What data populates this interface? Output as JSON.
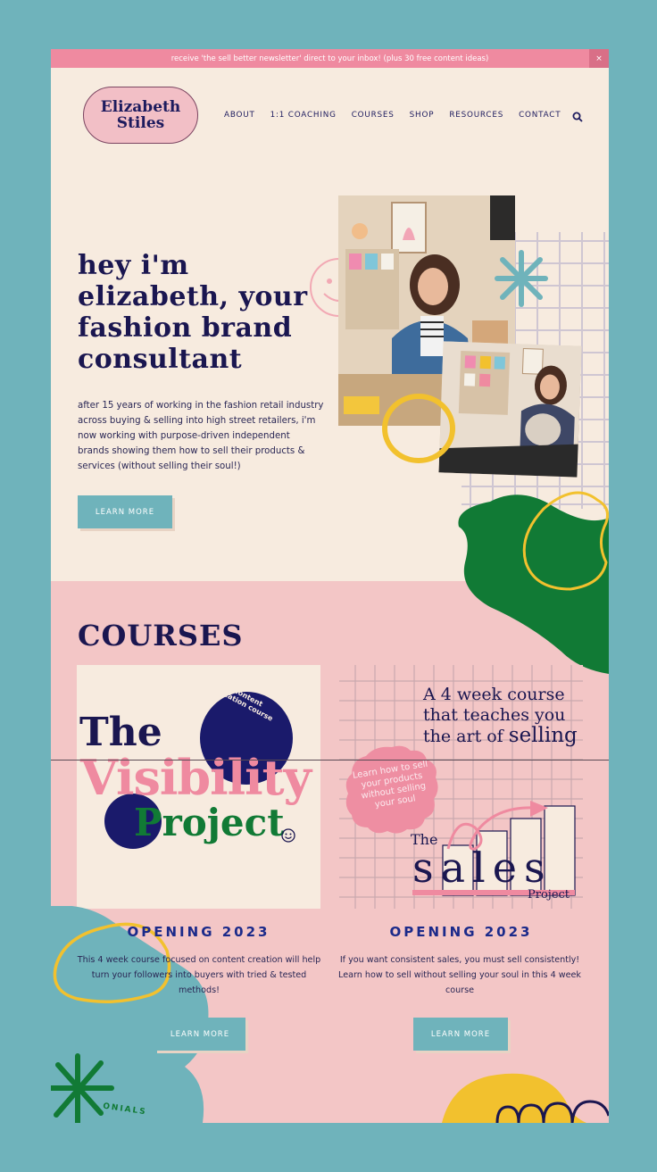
{
  "topbar": {
    "message": "receive 'the sell better newsletter' direct to your inbox! (plus 30 free content ideas)",
    "close": "×"
  },
  "logo": {
    "line1": "Elizabeth",
    "line2": "Stiles"
  },
  "nav": {
    "items": [
      "ABOUT",
      "1:1 COACHING",
      "COURSES",
      "SHOP",
      "RESOURCES",
      "CONTACT"
    ]
  },
  "hero": {
    "title_lines": [
      "hey i'm",
      "elizabeth, your",
      "fashion brand",
      "consultant"
    ],
    "text": "after 15 years of working in the fashion retail industry across buying & selling into high street retailers, i'm now working with purpose-driven independent brands showing them how to sell their products & services (without selling their soul!)",
    "button": "LEARN MORE"
  },
  "courses": {
    "title": "COURSES",
    "card1": {
      "badge": "the content creation course",
      "the": "The",
      "visibility": "Visibility",
      "project": "Project",
      "opening": "OPENING 2023",
      "desc": "This 4 week course focused on content creation will help turn your followers into buyers with tried & tested methods!",
      "button": "LEARN MORE"
    },
    "card2": {
      "tagline_line1": "A 4 week course",
      "tagline_line2": "that teaches you",
      "tagline_line3a": "the art of",
      "tagline_line3b": "selling",
      "sticker_line1": "Learn how to sell",
      "sticker_line2": "your products",
      "sticker_line3": "without selling",
      "sticker_line4": "your soul",
      "the": "The",
      "sales": "sales",
      "project": "Project",
      "opening": "OPENING 2023",
      "desc": "If you want consistent sales, you must sell consistently! Learn how to sell without selling your soul in this 4 week course",
      "button": "LEARN MORE"
    },
    "partial_heading": "ONIALS"
  },
  "colors": {
    "frame": "#6fb3bb",
    "cream": "#f7ebdf",
    "pink": "#f3c6c6",
    "navy": "#1a1650",
    "accent_pink": "#ef8aa0",
    "green": "#117a35",
    "yellow": "#f2c12e"
  }
}
